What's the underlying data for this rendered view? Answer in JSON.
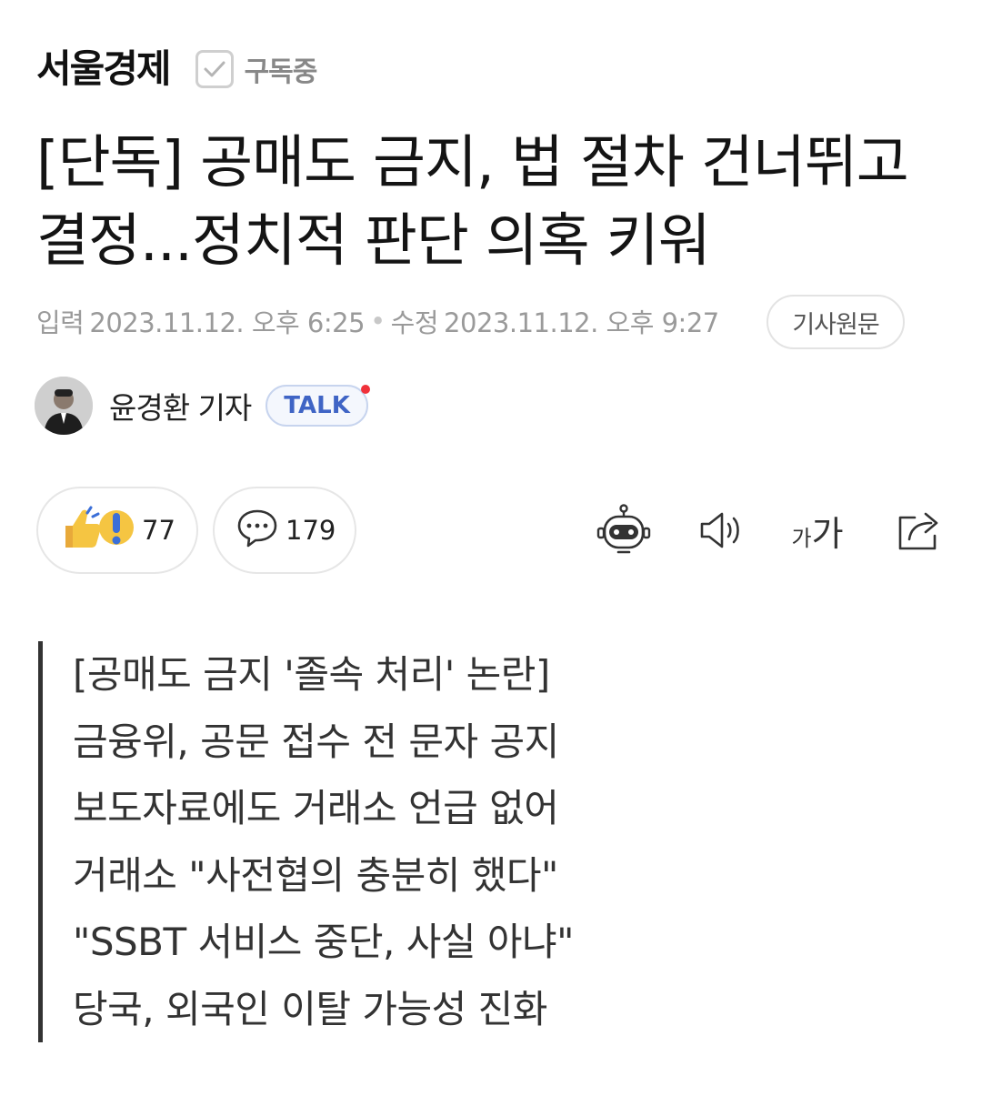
{
  "press": {
    "name": "서울경제",
    "subscribe_label": "구독중"
  },
  "headline": "[단독] 공매도 금지, 법 절차 건너뛰고 결정...정치적 판단 의혹 키워",
  "dates": {
    "published_label": "입력",
    "published": "2023.11.12. 오후 6:25",
    "modified_label": "수정",
    "modified": "2023.11.12. 오후 9:27",
    "original_button": "기사원문"
  },
  "reporter": {
    "name": "윤경환 기자",
    "talk_label": "TALK"
  },
  "reactions": {
    "like_count": "77",
    "comment_count": "179"
  },
  "toolbar": {
    "font_size_label_small": "가",
    "font_size_label_large": "가"
  },
  "summary": {
    "lines": [
      "[공매도 금지 '졸속 처리' 논란]",
      "금융위, 공문 접수 전 문자 공지",
      "보도자료에도 거래소 언급 없어",
      "거래소 \"사전협의 충분히 했다\"",
      "\"SSBT 서비스 중단, 사실 아냐\"",
      "당국, 외국인 이탈 가능성 진화"
    ]
  },
  "colors": {
    "accent_talk": "#3f64c5",
    "notification_dot": "#f0313a",
    "emoji_yellow": "#f5c542",
    "emoji_blue": "#3b6fd8"
  }
}
